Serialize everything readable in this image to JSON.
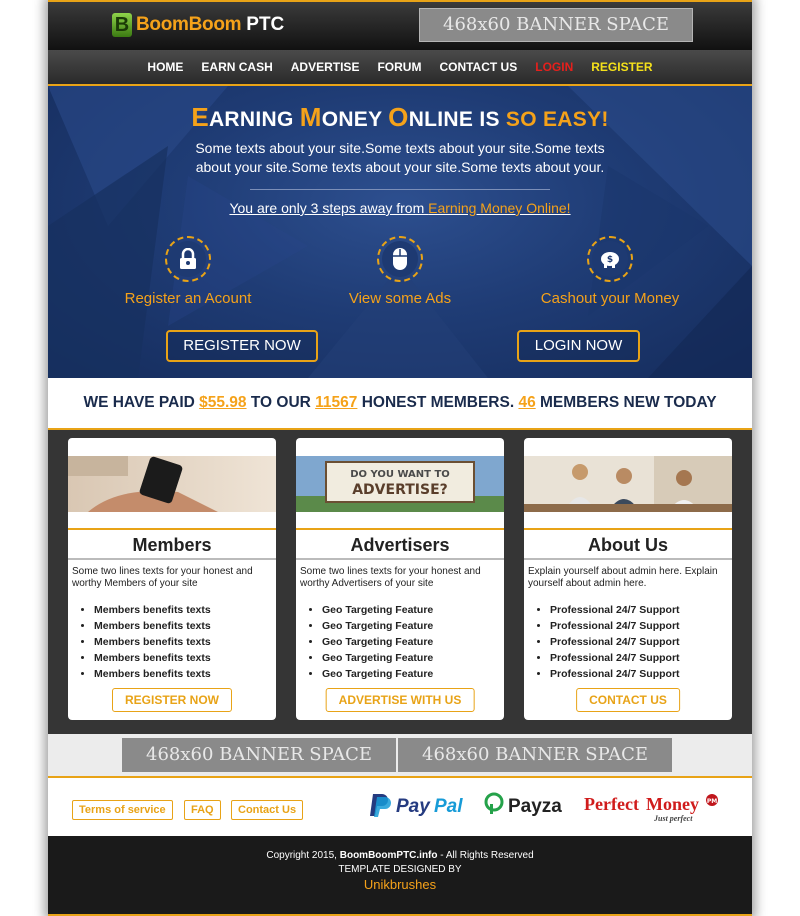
{
  "header": {
    "logo_text_1": "BoomBoom",
    "logo_text_2": "PTC",
    "logo_letter": "B",
    "banner_label": "468x60 BANNER SPACE"
  },
  "nav": {
    "items": [
      "HOME",
      "EARN CASH",
      "ADVERTISE",
      "FORUM",
      "CONTACT US",
      "LOGIN",
      "REGISTER"
    ]
  },
  "hero": {
    "title": {
      "e": "E",
      "arning": "ARNING ",
      "m": "M",
      "oney": "ONEY ",
      "o": "O",
      "nline": "NLINE ",
      "is": "IS ",
      "so_easy": "SO EASY!"
    },
    "text": "Some texts about your site.Some texts about your site.Some texts about your site.Some texts about your site.Some texts about your.",
    "steps_prefix": "You are only 3 steps away from ",
    "steps_link": "Earning Money Online!",
    "steps": [
      {
        "label": "Register an Acount",
        "icon": "lock-icon"
      },
      {
        "label": "View some Ads",
        "icon": "mouse-icon"
      },
      {
        "label": "Cashout your Money",
        "icon": "piggy-bank-icon"
      }
    ],
    "register_button": "REGISTER NOW",
    "login_button": "LOGIN NOW"
  },
  "stats": {
    "part1": "WE HAVE PAID ",
    "paid": "$55.98",
    "part2": " TO OUR ",
    "members": "11567",
    "part3": " HONEST MEMBERS. ",
    "new_today": "46",
    "part4": " MEMBERS NEW TODAY"
  },
  "cards": [
    {
      "title": "Members",
      "desc": "Some two lines texts for your honest and worthy Members of your site",
      "items": [
        "Members benefits texts",
        "Members benefits texts",
        "Members benefits texts",
        "Members benefits texts",
        "Members benefits texts"
      ],
      "button": "REGISTER NOW"
    },
    {
      "title": "Advertisers",
      "desc": "Some two lines texts for your honest and worthy Advertisers of your site",
      "items": [
        "Geo Targeting Feature",
        "Geo Targeting Feature",
        "Geo Targeting Feature",
        "Geo Targeting Feature",
        "Geo Targeting Feature"
      ],
      "button": "ADVERTISE WITH US",
      "image_text_1": "DO YOU WANT TO",
      "image_text_2": "ADVERTISE?"
    },
    {
      "title": "About Us",
      "desc": "Explain yourself about admin here. Explain yourself about admin here.",
      "items": [
        "Professional 24/7 Support",
        "Professional 24/7 Support",
        "Professional 24/7 Support",
        "Professional 24/7 Support",
        "Professional 24/7 Support"
      ],
      "button": "CONTACT US"
    }
  ],
  "banners": [
    "468x60 BANNER SPACE",
    "468x60 BANNER SPACE"
  ],
  "footer_links": [
    "Terms of service",
    "FAQ",
    "Contact Us"
  ],
  "payments": {
    "paypal_1": "Pay",
    "paypal_2": "Pal",
    "payza": "Payza",
    "perfect": "Perfect",
    "money": "Money",
    "just_perfect": "Just perfect",
    "pm_badge": "PM"
  },
  "footer": {
    "copyright_prefix": "Copyright 2015, ",
    "site": "BoomBoomPTC.info",
    "copyright_suffix": " - All Rights Reserved",
    "designed_by": "TEMPLATE DESIGNED BY",
    "designer": "Unikbrushes"
  },
  "colors": {
    "accent": "#e8a317",
    "hero_blue": "#1f3c75",
    "dark": "#353535"
  }
}
